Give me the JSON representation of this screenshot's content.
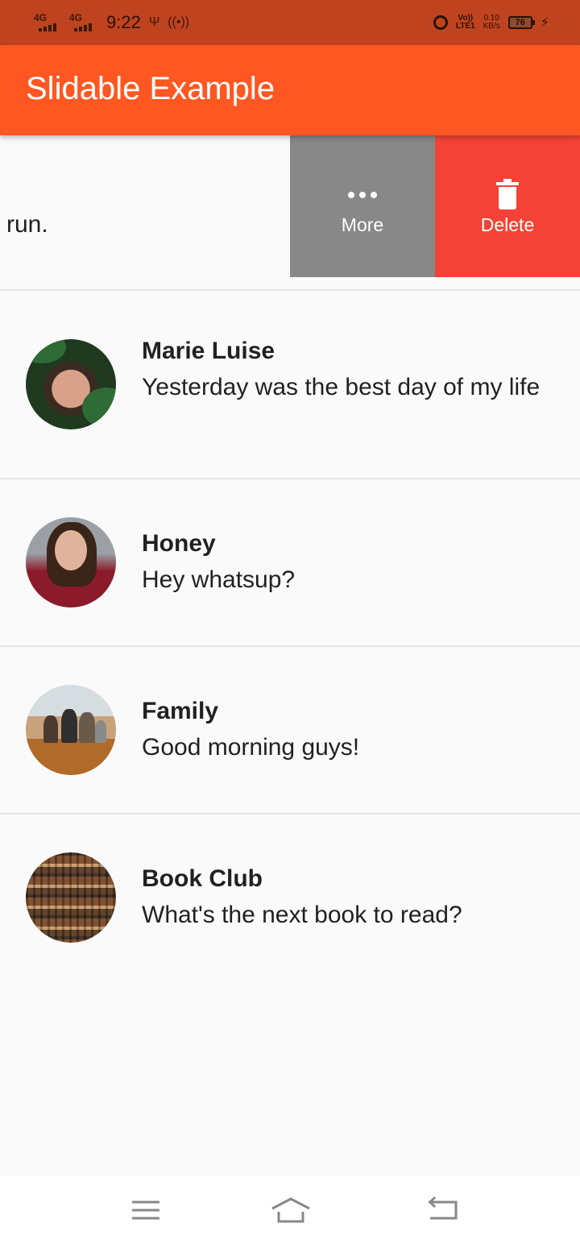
{
  "status_bar": {
    "signal1_label": "4G",
    "signal2_label": "4G",
    "time": "9:22",
    "volte_line1": "Vo))",
    "volte_line2": "LTE1",
    "speed_value": "0.10",
    "speed_unit": "KB/s",
    "battery": "76"
  },
  "app_bar": {
    "title": "Slidable Example"
  },
  "slid_item": {
    "text": "run.",
    "actions": [
      {
        "label": "More",
        "icon": "more-horiz-icon",
        "color": "#888888"
      },
      {
        "label": "Delete",
        "icon": "delete-icon",
        "color": "#f44336"
      }
    ]
  },
  "conversations": [
    {
      "name": "Marie Luise",
      "message": "Yesterday was the best day of my life",
      "avatar": "avatar-marie-luise"
    },
    {
      "name": "Honey",
      "message": "Hey whatsup?",
      "avatar": "avatar-honey"
    },
    {
      "name": "Family",
      "message": "Good morning guys!",
      "avatar": "avatar-family"
    },
    {
      "name": "Book Club",
      "message": "What's the next book to read?",
      "avatar": "avatar-book-club"
    }
  ],
  "nav_bar": {
    "menu_icon": "menu-icon",
    "home_icon": "home-icon",
    "back_icon": "back-icon"
  },
  "colors": {
    "status_bar": "#bf431e",
    "app_bar": "#ff5722",
    "more": "#888888",
    "delete": "#f44336"
  }
}
